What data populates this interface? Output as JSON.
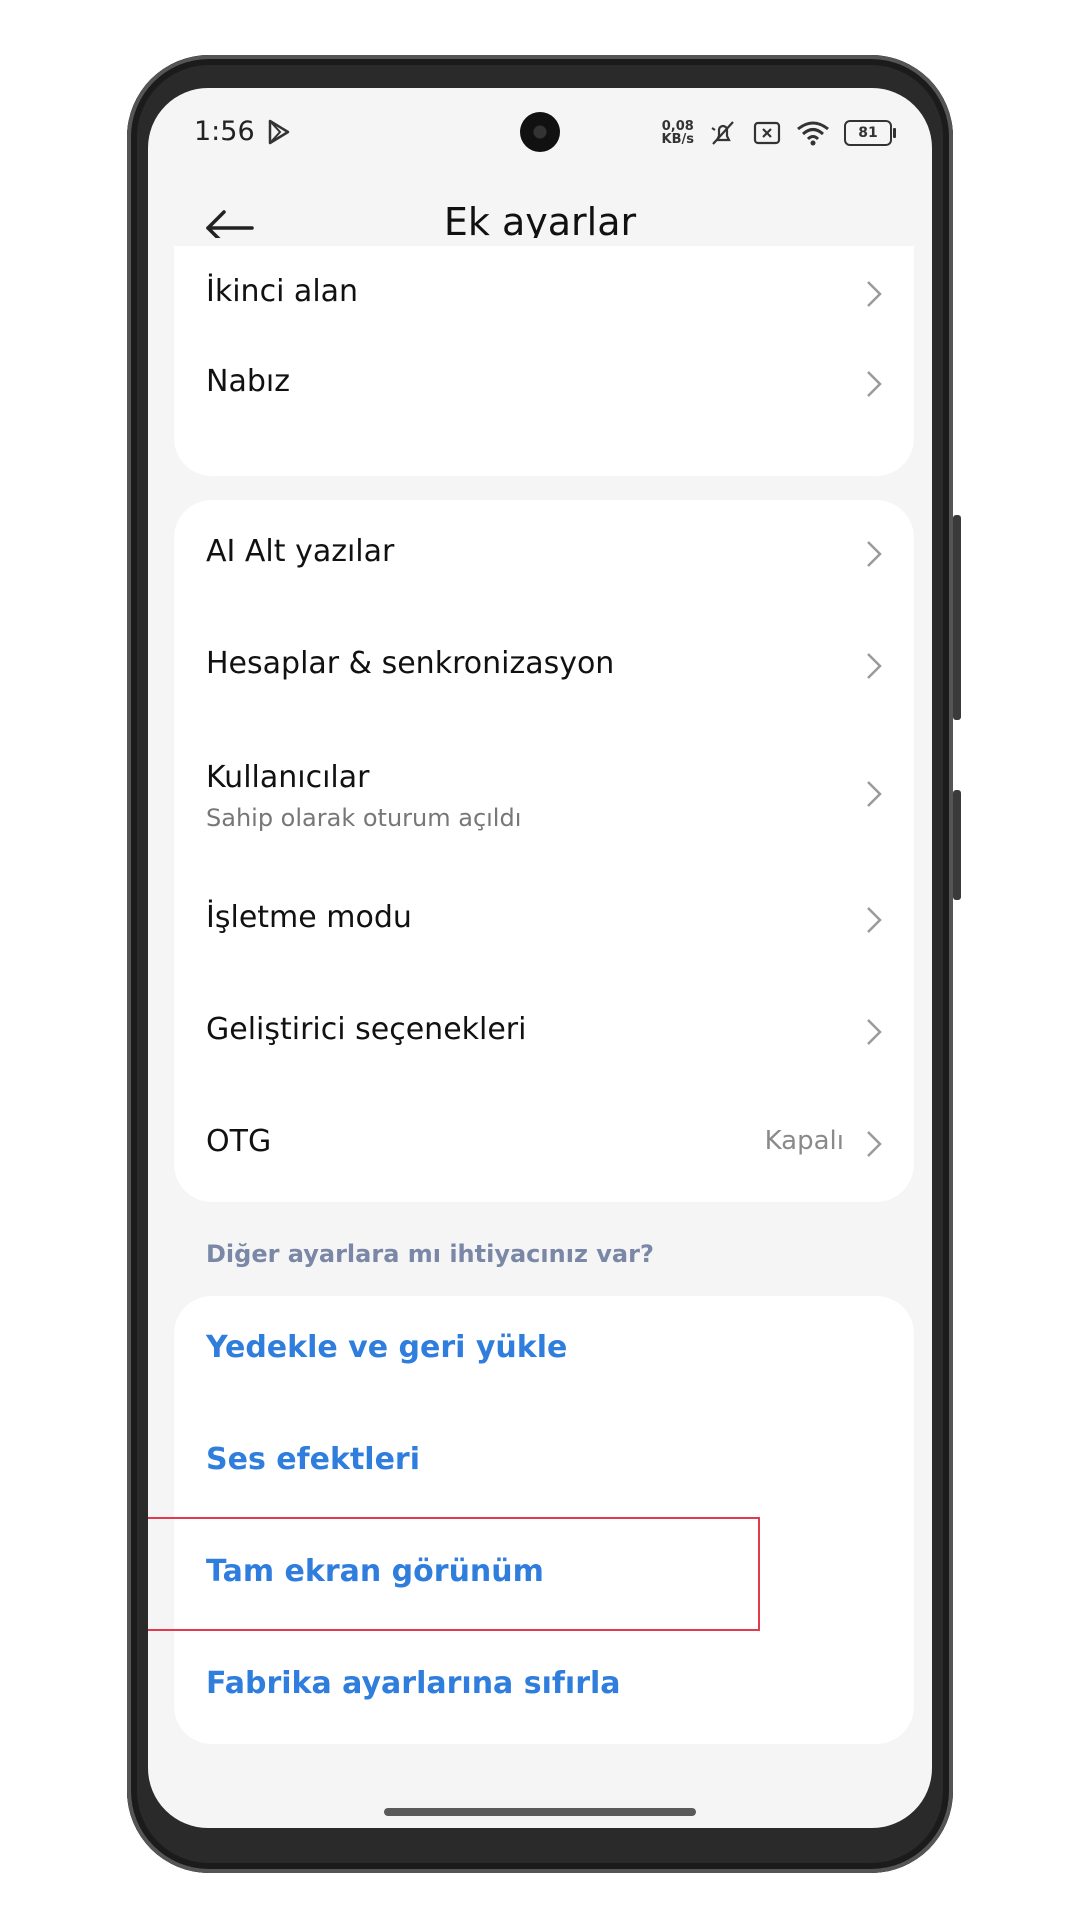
{
  "status_bar": {
    "time": "1:56",
    "speed_value": "0,08",
    "speed_unit": "KB/s",
    "battery": "81"
  },
  "header": {
    "title": "Ek ayarlar"
  },
  "group1": [
    {
      "label": "İkinci alan"
    },
    {
      "label": "Nabız"
    }
  ],
  "group2": [
    {
      "label": "AI Alt yazılar"
    },
    {
      "label": "Hesaplar & senkronizasyon"
    },
    {
      "label": "Kullanıcılar",
      "sublabel": "Sahip olarak oturum açıldı"
    },
    {
      "label": "İşletme modu"
    },
    {
      "label": "Geliştirici seçenekleri"
    },
    {
      "label": "OTG",
      "value": "Kapalı"
    }
  ],
  "more_settings": {
    "title": "Diğer ayarlara mı ihtiyacınız var?",
    "links": [
      {
        "label": "Yedekle ve geri yükle"
      },
      {
        "label": "Ses efektleri"
      },
      {
        "label": "Tam ekran görünüm"
      },
      {
        "label": "Fabrika ayarlarına sıfırla"
      }
    ]
  },
  "colors": {
    "link": "#2f7ddd",
    "highlight": "#e23a4f",
    "background": "#f5f5f5"
  }
}
